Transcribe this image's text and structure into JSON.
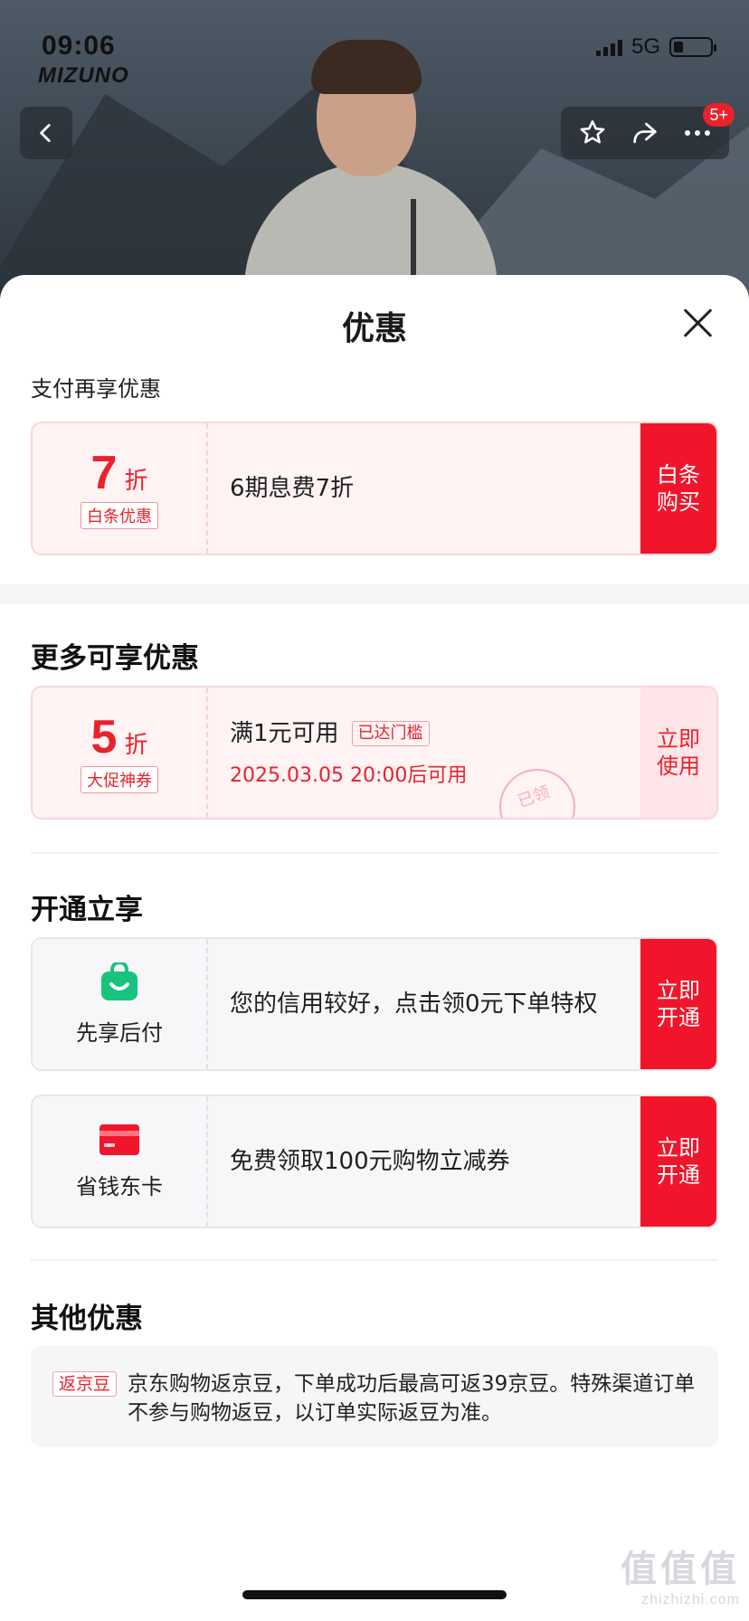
{
  "status_bar": {
    "time": "09:06",
    "network": "5G"
  },
  "hero": {
    "brand": "MIZUNO",
    "badge_count": "5+"
  },
  "sheet": {
    "title": "优惠",
    "pay_section": {
      "heading": "支付再享优惠",
      "coupon": {
        "discount": "7",
        "unit": "折",
        "tag": "白条优惠",
        "description": "6期息费7折",
        "action": "白条购买"
      }
    },
    "more_section": {
      "heading": "更多可享优惠",
      "coupon": {
        "discount": "5",
        "unit": "折",
        "tag": "大促神券",
        "description": "满1元可用",
        "threshold_tag": "已达门槛",
        "validity": "2025.03.05 20:00后可用",
        "stamp": "已领",
        "action": "立即使用"
      }
    },
    "open_section": {
      "heading": "开通立享",
      "items": [
        {
          "label": "先享后付",
          "icon": "shopping-bag-icon",
          "description": "您的信用较好，点击领0元下单特权",
          "action": "立即开通"
        },
        {
          "label": "省钱东卡",
          "icon": "bank-card-icon",
          "description": "免费领取100元购物立减券",
          "action": "立即开通"
        }
      ]
    },
    "other_section": {
      "heading": "其他优惠",
      "tag": "返京豆",
      "description": "京东购物返京豆，下单成功后最高可返39京豆。特殊渠道订单不参与购物返豆，以订单实际返豆为准。"
    }
  },
  "watermark": {
    "big": "值值值",
    "small": "zhizhizhi.com"
  },
  "colors": {
    "accent": "#f0152a",
    "accent_text": "#e8232d",
    "green": "#19c37d",
    "pink_bg": "#fff3f4"
  }
}
